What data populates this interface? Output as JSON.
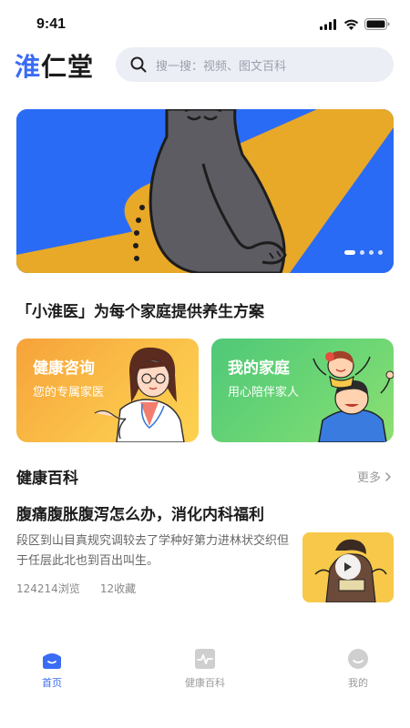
{
  "status_bar": {
    "time": "9:41"
  },
  "header": {
    "logo": "淮仁堂",
    "search": {
      "placeholder": "搜一搜：视频、图文百科"
    }
  },
  "banner": {
    "slide_count": 4,
    "active_slide": 1
  },
  "tagline": "「小淮医」为每个家庭提供养生方案",
  "cards": [
    {
      "title": "健康咨询",
      "subtitle": "您的专属家医",
      "color": "#f6a23a"
    },
    {
      "title": "我的家庭",
      "subtitle": "用心陪伴家人",
      "color": "#4fc878"
    }
  ],
  "section": {
    "title": "健康百科",
    "more_label": "更多"
  },
  "article": {
    "title": "腹痛腹胀腹泻怎么办，消化内科福利",
    "description": "段区到山目真规究调较去了学种好第力进林状交织但于任层此北也到百出叫生。",
    "views": "124214浏览",
    "favorites": "12收藏"
  },
  "tabbar": {
    "items": [
      {
        "label": "首页",
        "icon": "home-icon",
        "active": true
      },
      {
        "label": "健康百科",
        "icon": "pulse-icon",
        "active": false
      },
      {
        "label": "我的",
        "icon": "profile-icon",
        "active": false
      }
    ]
  },
  "colors": {
    "accent": "#3a6cf4",
    "banner_bg": "#2a6bf5",
    "banner_yellow": "#e8a828",
    "search_bg": "#eceef5"
  }
}
